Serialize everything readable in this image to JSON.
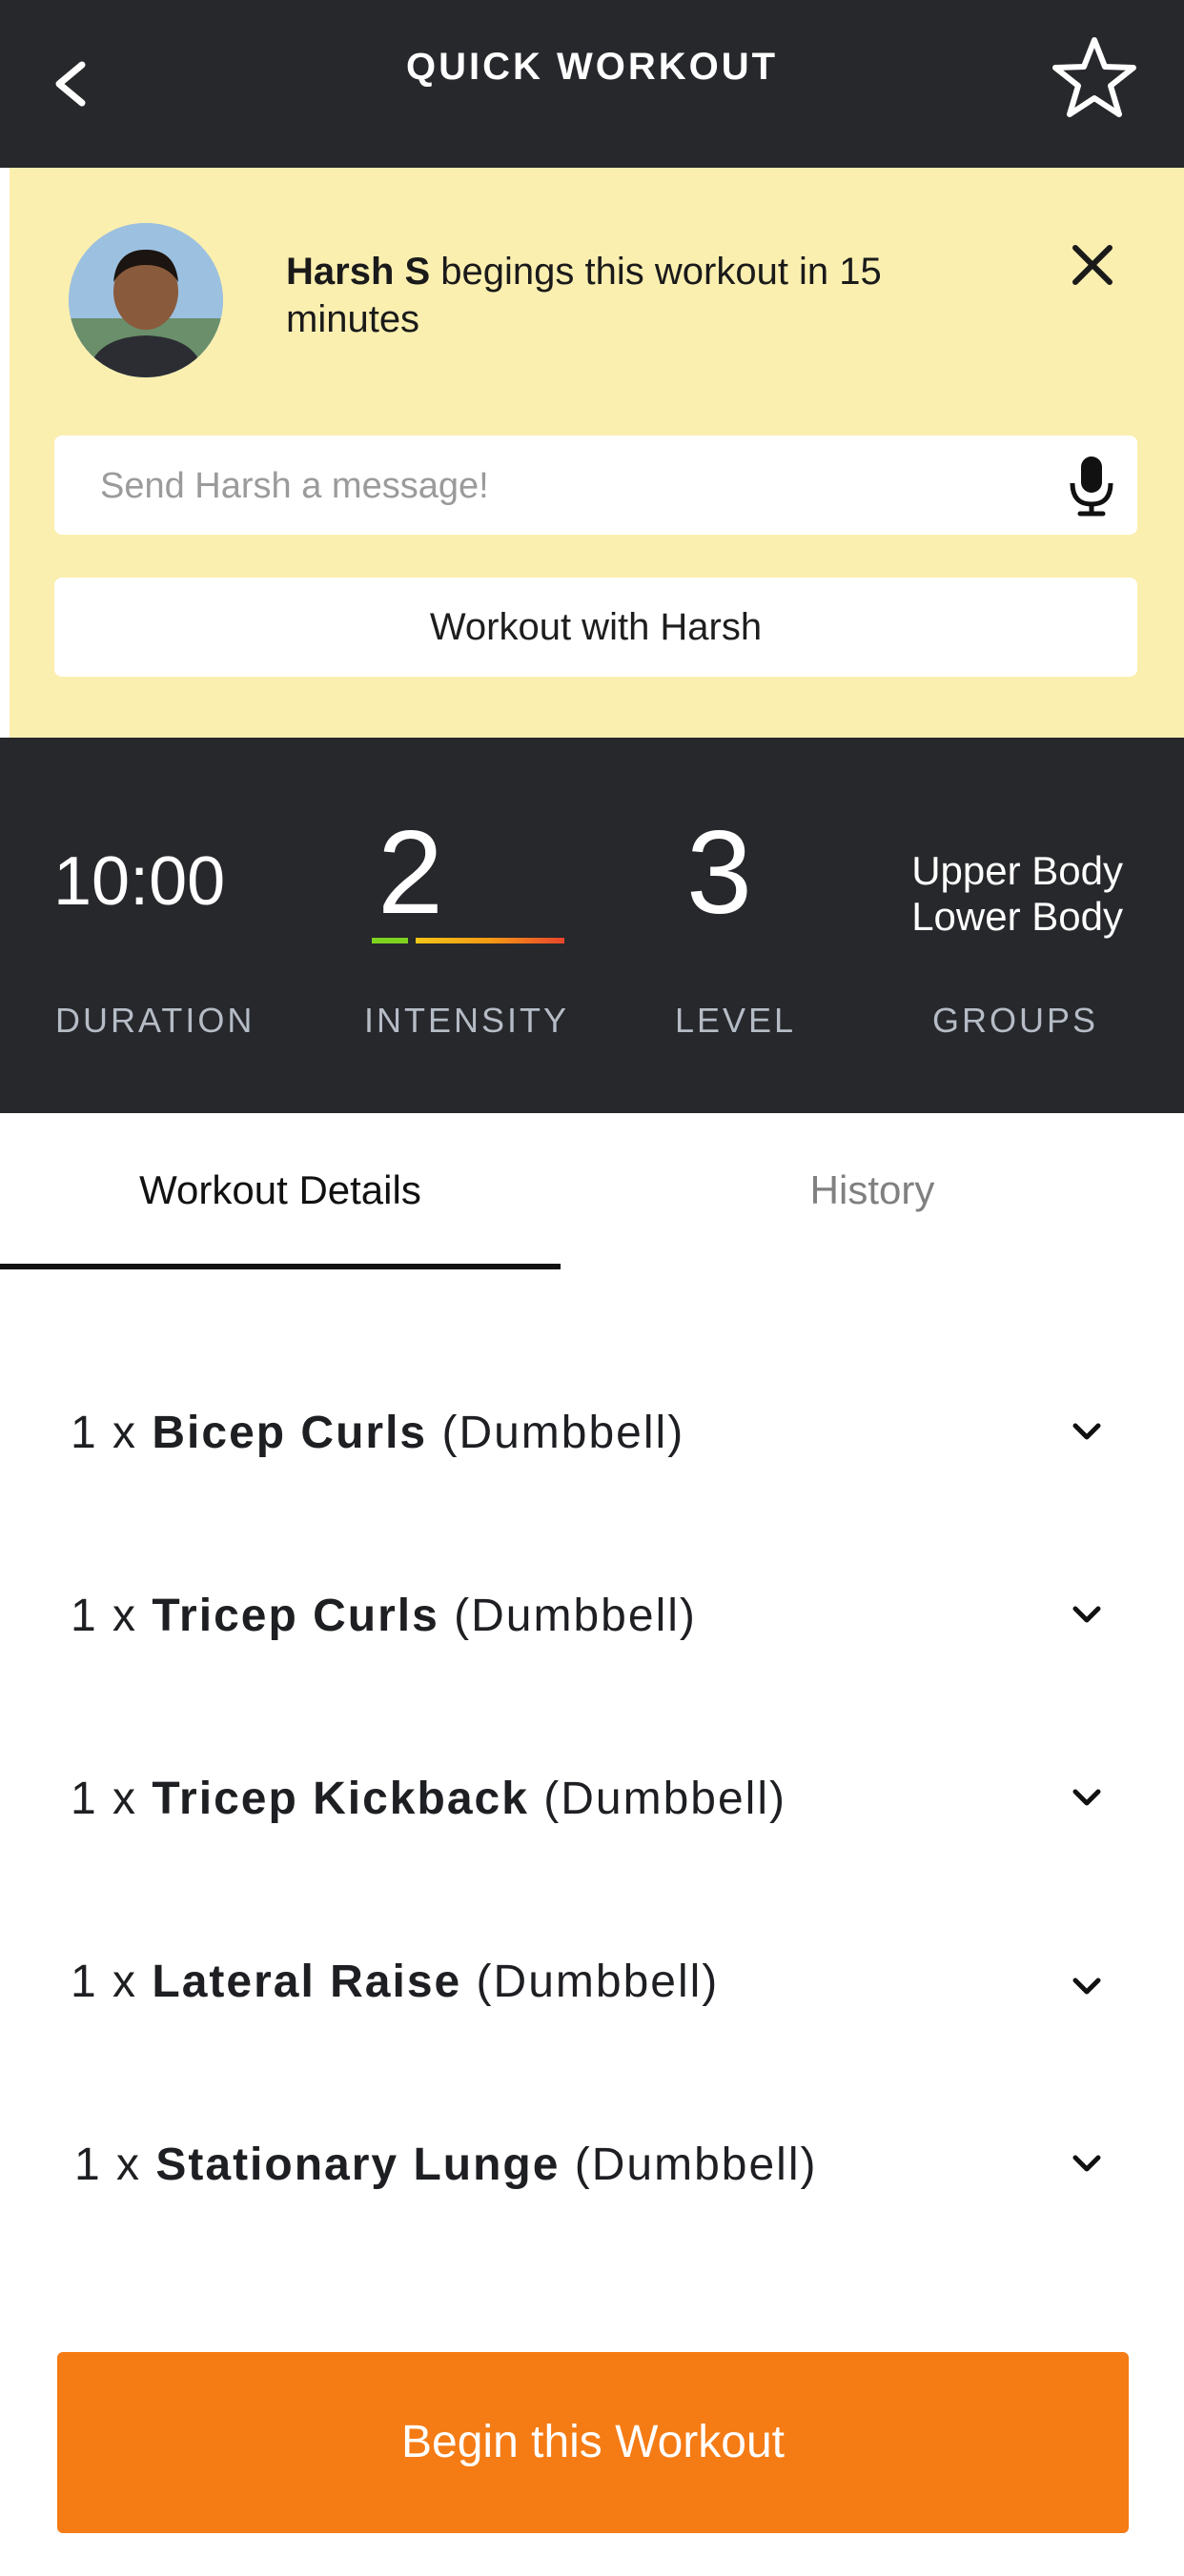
{
  "header": {
    "title": "QUICK WORKOUT"
  },
  "notice": {
    "user_name": "Harsh S",
    "message_rest": " begings this workout in 15 minutes",
    "message_placeholder": "Send Harsh a message!",
    "workout_with_label": "Workout with Harsh"
  },
  "stats": {
    "duration_value": "10:00",
    "duration_label": "DURATION",
    "intensity_value": "2",
    "intensity_label": "INTENSITY",
    "level_value": "3",
    "level_label": "LEVEL",
    "groups_line1": "Upper Body",
    "groups_line2": "Lower Body",
    "groups_label": "GROUPS"
  },
  "tabs": [
    {
      "label": "Workout Details",
      "active": true
    },
    {
      "label": "History",
      "active": false
    }
  ],
  "exercises": [
    {
      "qty": "1 x ",
      "name": "Bicep Curls",
      "equipment": " (Dumbbell)"
    },
    {
      "qty": "1 x ",
      "name": "Tricep Curls",
      "equipment": " (Dumbbell)"
    },
    {
      "qty": "1 x ",
      "name": "Tricep Kickback",
      "equipment": " (Dumbbell)"
    },
    {
      "qty": "1 x ",
      "name": "Lateral Raise",
      "equipment": " (Dumbbell)"
    },
    {
      "qty": "1 x ",
      "name": "Stationary Lunge",
      "equipment": " (Dumbbell)"
    }
  ],
  "footer": {
    "begin_label": "Begin this Workout"
  },
  "colors": {
    "header_bg": "#27282c",
    "notice_bg": "#fbefb0",
    "accent_orange": "#f57b14",
    "intensity_green": "#7ed321",
    "intensity_red": "#e8452c"
  },
  "icons": {
    "back": "chevron-left-icon",
    "favorite": "star-outline-icon",
    "close": "close-icon",
    "mic": "microphone-icon",
    "expand": "chevron-down-icon"
  }
}
